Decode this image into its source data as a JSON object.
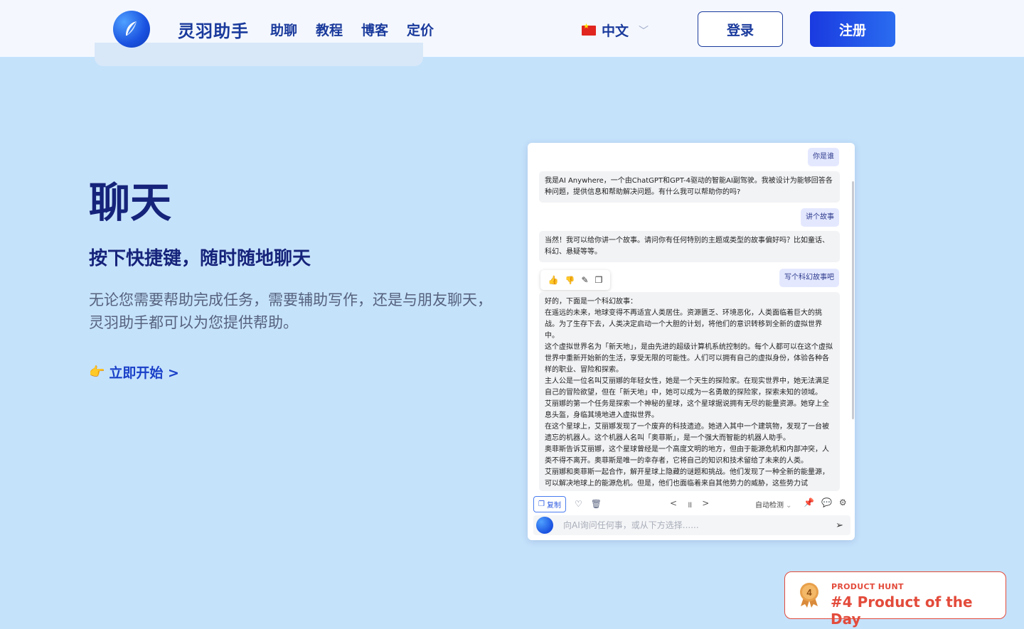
{
  "header": {
    "brand": "灵羽助手",
    "nav": [
      "助聊",
      "教程",
      "博客",
      "定价"
    ],
    "language": "中文",
    "login": "登录",
    "register": "注册"
  },
  "hero": {
    "title": "聊天",
    "subtitle": "按下快捷键，随时随地聊天",
    "description": "无论您需要帮助完成任务，需要辅助写作，还是与朋友聊天，灵羽助手都可以为您提供帮助。",
    "cta_hand": "👉",
    "cta": "立即开始 >"
  },
  "chat": {
    "messages": [
      {
        "role": "user",
        "text": "你是谁"
      },
      {
        "role": "ai",
        "text": "我是AI Anywhere，一个由ChatGPT和GPT-4驱动的智能AI副驾驶。我被设计为能够回答各种问题，提供信息和帮助解决问题。有什么我可以帮助你的吗?"
      },
      {
        "role": "user",
        "text": "讲个故事"
      },
      {
        "role": "ai",
        "text": "当然！我可以给你讲一个故事。请问你有任何特别的主题或类型的故事偏好吗？比如童话、科幻、悬疑等等。"
      },
      {
        "role": "user",
        "text": "写个科幻故事吧"
      }
    ],
    "story_lines": [
      "好的，下面是一个科幻故事：",
      "在遥远的未来，地球变得不再适宜人类居住。资源匮乏、环境恶化，人类面临着巨大的挑战。为了生存下去，人类决定启动一个大胆的计划，将他们的意识转移到全新的虚拟世界中。",
      "这个虚拟世界名为「新天地」，是由先进的超级计算机系统控制的。每个人都可以在这个虚拟世界中重新开始新的生活，享受无限的可能性。人们可以拥有自己的虚拟身份，体验各种各样的职业、冒险和探索。",
      "主人公是一位名叫艾丽娜的年轻女性，她是一个天生的探险家。在现实世界中，她无法满足自己的冒险欲望，但在「新天地」中，她可以成为一名勇敢的探险家，探索未知的领域。",
      "艾丽娜的第一个任务是探索一个神秘的星球，这个星球据说拥有无尽的能量资源。她穿上全息头盔，身临其境地进入虚拟世界。",
      "在这个星球上，艾丽娜发现了一个废弃的科技遗迹。她进入其中一个建筑物，发现了一台被遗忘的机器人。这个机器人名叫「奥菲斯」，是一个强大而智能的机器人助手。",
      "奥菲斯告诉艾丽娜，这个星球曾经是一个高度文明的地方，但由于能源危机和内部冲突，人类不得不离开。奥菲斯是唯一的幸存者，它将自己的知识和技术留给了未来的人类。",
      "艾丽娜和奥菲斯一起合作，解开星球上隐藏的谜题和挑战。他们发现了一种全新的能量源，可以解决地球上的能源危机。但是，他们也面临着来自其他势力的威胁，这些势力试"
    ],
    "toolbar": {
      "copy": "复制",
      "auto_detect": "自动检测"
    },
    "input_placeholder": "向AI询问任何事，或从下方选择......"
  },
  "product_hunt": {
    "label": "PRODUCT HUNT",
    "rank": "4",
    "title": "#4 Product of the Day"
  },
  "colors": {
    "background": "#c5e2fb",
    "header_bg": "#f4f8fe",
    "brand_blue": "#1a3a9c",
    "register_btn": "#1a3ae0",
    "product_hunt": "#e34b3b"
  }
}
